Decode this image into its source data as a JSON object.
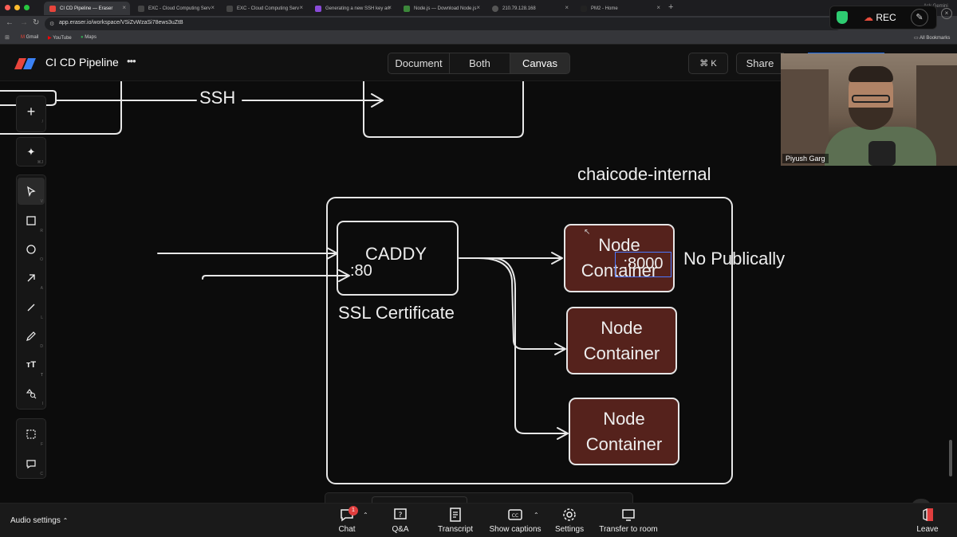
{
  "browser": {
    "tabs": [
      {
        "title": "CI CD Pipeline — Eraser",
        "active": true
      },
      {
        "title": "EXC - Cloud Computing Serv"
      },
      {
        "title": "EXC - Cloud Computing Serv"
      },
      {
        "title": "Generating a new SSH key an"
      },
      {
        "title": "Node.js — Download Node.js"
      },
      {
        "title": "210.79.128.168"
      },
      {
        "title": "PM2 - Home"
      }
    ],
    "url": "app.eraser.io/workspace/VSiZvWzaSi78ews3uZtB",
    "bookmarks": [
      "Gmail",
      "YouTube",
      "Maps"
    ],
    "all_bookmarks": "All Bookmarks",
    "ask_gemini": "Ask Gemini",
    "rec_label": "REC"
  },
  "app": {
    "doc_title": "CI CD Pipeline",
    "more": "•••",
    "view_tabs": [
      "Document",
      "Both",
      "Canvas"
    ],
    "active_view": "Canvas",
    "shortcut": "⌘ K",
    "share": "Share"
  },
  "tools": [
    {
      "name": "add",
      "shortcut": "/"
    },
    {
      "name": "ai",
      "shortcut": "⌘J"
    },
    {
      "name": "select",
      "shortcut": "V"
    },
    {
      "name": "rectangle",
      "shortcut": "R"
    },
    {
      "name": "circle",
      "shortcut": "O"
    },
    {
      "name": "arrow",
      "shortcut": "A"
    },
    {
      "name": "line",
      "shortcut": "L"
    },
    {
      "name": "pencil",
      "shortcut": "D"
    },
    {
      "name": "text",
      "shortcut": "T"
    },
    {
      "name": "shapes",
      "shortcut": "I"
    },
    {
      "name": "frame",
      "shortcut": "F"
    },
    {
      "name": "comment",
      "shortcut": "C"
    }
  ],
  "canvas": {
    "ssh_label": "SSH",
    "group_title": "chaicode-internal",
    "caddy": "CADDY",
    "port80": ":80",
    "ssl": "SSL Certificate",
    "node1_line1": "Node",
    "node1_line2": "Container",
    "port8000": ":8000",
    "no_public": "No Publically",
    "node2_line1": "Node",
    "node2_line2": "Container",
    "node3_line1": "Node",
    "node3_line2": "Container"
  },
  "video": {
    "speaker": "Piyush Garg"
  },
  "meeting_bar": {
    "audio_settings": "Audio settings",
    "chat": "Chat",
    "chat_badge": "1",
    "qa": "Q&A",
    "transcript": "Transcript",
    "captions": "Show captions",
    "settings": "Settings",
    "transfer": "Transfer to room",
    "leave": "Leave"
  },
  "colors": {
    "node_fill": "#55221c",
    "canvas_bg": "#0c0c0c",
    "accent": "#1f6feb"
  }
}
